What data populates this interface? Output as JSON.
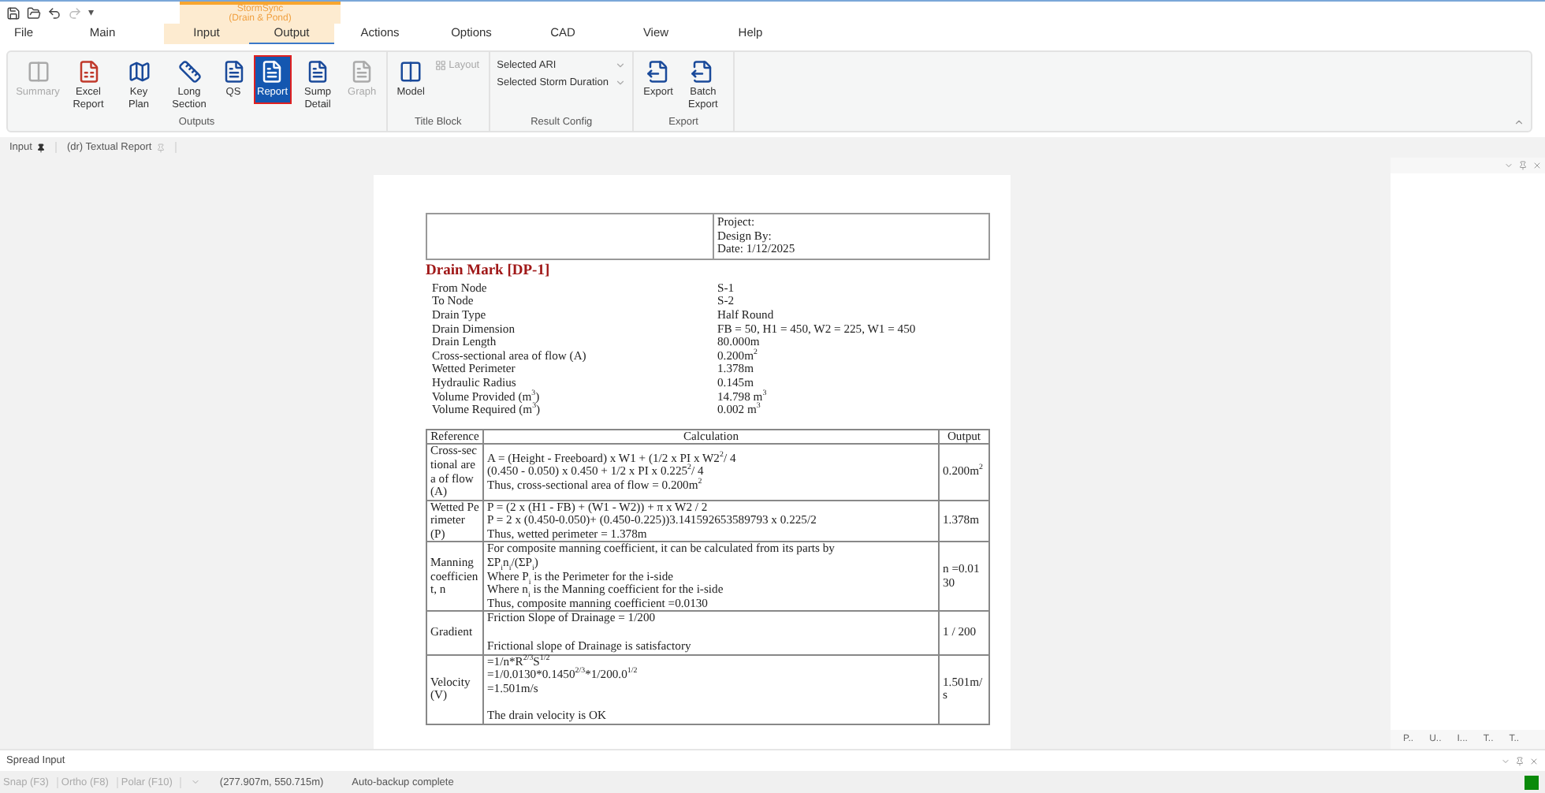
{
  "quick_access": {
    "buttons": [
      {
        "disabled": false
      },
      {
        "disabled": false
      },
      {
        "disabled": false
      },
      {
        "disabled": true
      }
    ],
    "menu": "▾"
  },
  "context_tab": {
    "title": "StormSync",
    "subtitle": "(Drain & Pond)"
  },
  "menu_tabs": [
    {
      "label": "File",
      "selected": false
    },
    {
      "label": "Main",
      "selected": false
    },
    {
      "label": "Input",
      "selected": false,
      "contextual": true
    },
    {
      "label": "Output",
      "selected": true,
      "contextual": true
    },
    {
      "label": "Actions",
      "selected": false
    },
    {
      "label": "Options",
      "selected": false
    },
    {
      "label": "CAD",
      "selected": false
    },
    {
      "label": "View",
      "selected": false
    },
    {
      "label": "Help",
      "selected": false
    }
  ],
  "ribbon_groups": [
    {
      "title": "Outputs",
      "buttons": [
        {
          "label": "Summary",
          "disabled": true,
          "selected": false
        },
        {
          "label": "Excel Report",
          "disabled": false,
          "selected": false
        },
        {
          "label": "Key Plan",
          "disabled": false,
          "selected": false
        },
        {
          "label": "Long Section",
          "disabled": false,
          "selected": false
        },
        {
          "label": "QS",
          "disabled": false,
          "selected": false
        },
        {
          "label": "Report",
          "disabled": false,
          "selected": true
        },
        {
          "label": "Sump Detail",
          "disabled": false,
          "selected": false
        },
        {
          "label": "Graph",
          "disabled": true,
          "selected": false
        }
      ]
    },
    {
      "title": "Title Block",
      "buttons": [
        {
          "label": "Model",
          "kind": "large",
          "disabled": false,
          "selected": false
        },
        {
          "label": "Layout",
          "kind": "small",
          "disabled": true,
          "selected": false
        }
      ]
    },
    {
      "title": "Result Config",
      "dropdowns": [
        {
          "label": "Selected ARI"
        },
        {
          "label": "Selected Storm Duration"
        }
      ]
    },
    {
      "title": "Export",
      "buttons": [
        {
          "label": "Export",
          "disabled": false,
          "selected": false
        },
        {
          "label": "Batch Export",
          "disabled": false,
          "selected": false
        }
      ]
    }
  ],
  "doc_tabs": [
    {
      "label": "Input",
      "pinned": true
    },
    {
      "label": "(dr) Textual Report",
      "pinned": false
    }
  ],
  "report": {
    "header": [
      "Project:",
      "Design By:",
      "Date: 1/12/2025"
    ],
    "title": "Drain Mark [DP-1]",
    "properties": [
      {
        "name": "From Node",
        "value": "S-1"
      },
      {
        "name": "To Node",
        "value": "S-2"
      },
      {
        "name": "Drain Type",
        "value": "Half Round"
      },
      {
        "name": "Drain Dimension",
        "value": "FB = 50, H1 = 450, W2 = 225, W1 = 450"
      },
      {
        "name": "Drain Length",
        "value": "80.000m"
      },
      {
        "name": "Cross-sectional area of flow (A)",
        "value": "0.200m$^{2}$"
      },
      {
        "name": "Wetted Perimeter",
        "value": "1.378m"
      },
      {
        "name": "Hydraulic Radius",
        "value": "0.145m"
      },
      {
        "name": "Volume Provided (m$^{3}$)",
        "value": "14.798 m$^{3}$"
      },
      {
        "name": "Volume Required (m$^{3}$)",
        "value": "0.002 m$^{3}$"
      }
    ],
    "table": {
      "columns": [
        "Reference",
        "Calculation",
        "Output"
      ],
      "rows": [
        {
          "reference": "Cross-sectional area of flow (A)",
          "calculation": [
            [
              "A = (Height - Freeboard) x W1 + (1/2 x PI x W2$^{2}$/ 4",
              "(0.450 - 0.050) x 0.450 + 1/2 x PI x 0.225$^{2}$/ 4",
              "Thus, cross-sectional area of flow = 0.200m$^{2}$"
            ]
          ],
          "output": "0.200m$^{2}$"
        },
        {
          "reference": "Wetted Perimeter (P)",
          "calculation": [
            [
              "P = (2 x (H1 - FB) + (W1 - W2)) + π x W2 / 2",
              "P = 2 x (0.450-0.050)+ (0.450-0.225))3.141592653589793 x 0.225/2",
              "Thus, wetted perimeter = 1.378m"
            ]
          ],
          "output": "1.378m"
        },
        {
          "reference": "Manning coefficient, n",
          "calculation": [
            [
              "For composite manning coefficient, it can be calculated from its parts by",
              "ΣP$_{i}$n$_{i}$/(ΣP$_{i}$)",
              "Where P$_{i}$ is the Perimeter for the i-side",
              "Where n$_{i}$ is the Manning coefficient for the i-side",
              "Thus, composite manning coefficient =0.0130"
            ]
          ],
          "output": "n =0.0130"
        },
        {
          "reference": "Gradient",
          "calculation": [
            [
              "Friction Slope of Drainage = 1/200"
            ],
            [
              "Frictional slope of Drainage is satisfactory"
            ]
          ],
          "output": "1 / 200"
        },
        {
          "reference": "Velocity (V)",
          "calculation": [
            [
              "=1/n*R$^{2/3}$S$^{1/2}$",
              "=1/0.0130*0.1450$^{2/3}$*1/200.0$^{1/2}$",
              "=1.501m/s"
            ],
            [
              "The drain velocity is OK"
            ]
          ],
          "output": "1.501m/s"
        }
      ]
    }
  },
  "side_tabs": [
    "P..",
    "U..",
    "I...",
    "T..",
    "T.."
  ],
  "spread_input": {
    "title": "Spread Input"
  },
  "status_bar": {
    "toggles": [
      {
        "label": "Snap (F3)",
        "on": false
      },
      {
        "label": "Ortho (F8)",
        "on": false
      },
      {
        "label": "Polar (F10)",
        "on": false
      }
    ],
    "coordinates": "(277.907m, 550.715m)",
    "message": "Auto-backup complete"
  }
}
